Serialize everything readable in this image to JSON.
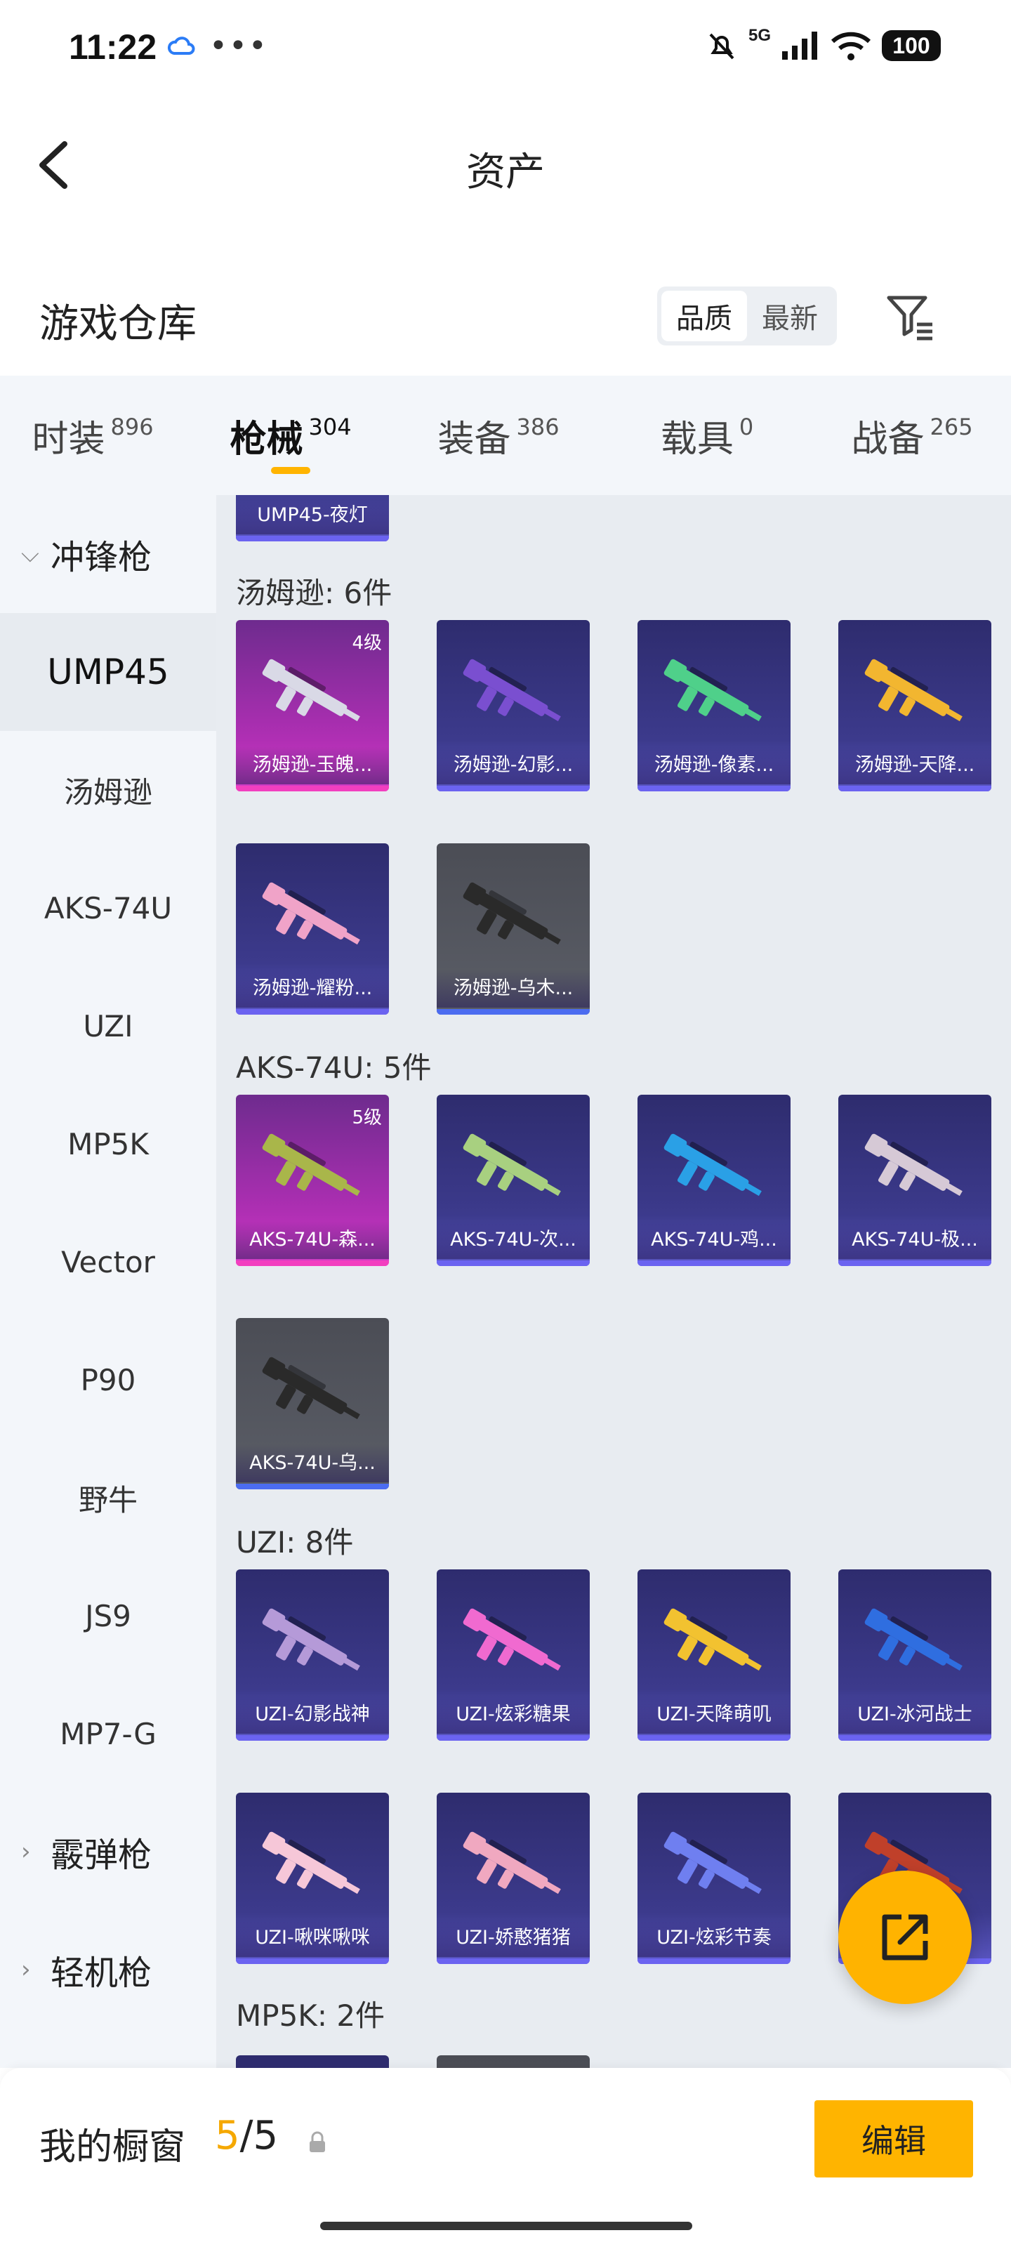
{
  "status_bar": {
    "time": "11:22",
    "network": "5G",
    "battery": "100"
  },
  "header": {
    "title": "资产"
  },
  "warehouse": {
    "title": "游戏仓库",
    "sort_options": [
      "品质",
      "最新"
    ],
    "active_sort": "品质"
  },
  "category_tabs": [
    {
      "label": "时装",
      "count": "896"
    },
    {
      "label": "枪械",
      "count": "304",
      "active": true
    },
    {
      "label": "装备",
      "count": "386"
    },
    {
      "label": "载具",
      "count": "0"
    },
    {
      "label": "战备",
      "count": "265"
    }
  ],
  "sidebar": {
    "group_smg": "冲锋枪",
    "items": [
      "UMP45",
      "汤姆逊",
      "AKS-74U",
      "UZI",
      "MP5K",
      "Vector",
      "P90",
      "野牛",
      "JS9",
      "MP7-G"
    ],
    "active_item": "UMP45",
    "group_shotgun": "霰弹枪",
    "group_lmg": "轻机枪"
  },
  "sections": {
    "prev_card": {
      "name": "UMP45-夜灯"
    },
    "thompson": {
      "title": "汤姆逊: 6件",
      "cards": [
        {
          "name": "汤姆逊-玉魄...",
          "level": "4级",
          "rarity": "legendary",
          "gun_color": "#d9d9e6"
        },
        {
          "name": "汤姆逊-幻影...",
          "rarity": "epic",
          "gun_color": "#7a4fd0"
        },
        {
          "name": "汤姆逊-像素...",
          "rarity": "epic",
          "gun_color": "#4fd08a"
        },
        {
          "name": "汤姆逊-天降...",
          "rarity": "epic",
          "gun_color": "#f2b630"
        },
        {
          "name": "汤姆逊-耀粉...",
          "rarity": "epic",
          "gun_color": "#f0a3c8"
        },
        {
          "name": "汤姆逊-乌木...",
          "rarity": "rare",
          "gun_color": "#2a2a2a"
        }
      ]
    },
    "aks": {
      "title": "AKS-74U: 5件",
      "cards": [
        {
          "name": "AKS-74U-森...",
          "level": "5级",
          "rarity": "legendary",
          "gun_color": "#a9b64a"
        },
        {
          "name": "AKS-74U-次...",
          "rarity": "epic",
          "gun_color": "#a8d080"
        },
        {
          "name": "AKS-74U-鸡...",
          "rarity": "epic",
          "gun_color": "#2aa0e6"
        },
        {
          "name": "AKS-74U-极...",
          "rarity": "epic",
          "gun_color": "#d6c9d6"
        },
        {
          "name": "AKS-74U-乌...",
          "rarity": "rare",
          "gun_color": "#2a2a2a"
        }
      ]
    },
    "uzi": {
      "title": "UZI: 8件",
      "cards": [
        {
          "name": "UZI-幻影战神",
          "rarity": "epic",
          "gun_color": "#b59ad8"
        },
        {
          "name": "UZI-炫彩糖果",
          "rarity": "epic",
          "gun_color": "#f06ad0"
        },
        {
          "name": "UZI-天降萌叽",
          "rarity": "epic",
          "gun_color": "#f2c230"
        },
        {
          "name": "UZI-冰河战士",
          "rarity": "epic",
          "gun_color": "#2f6ee0"
        },
        {
          "name": "UZI-啾咪啾咪",
          "rarity": "epic",
          "gun_color": "#f6c7d8"
        },
        {
          "name": "UZI-娇憨猪猪",
          "rarity": "epic",
          "gun_color": "#f0a8c0"
        },
        {
          "name": "UZI-炫彩节奏",
          "rarity": "epic",
          "gun_color": "#6f7ff0"
        },
        {
          "name": "",
          "rarity": "epic",
          "gun_color": "#c0402a"
        }
      ]
    },
    "mp5k": {
      "title": "MP5K: 2件"
    }
  },
  "bottom_bar": {
    "showcase_label": "我的橱窗",
    "showcase_current": "5",
    "showcase_total": "/5",
    "edit_label": "编辑"
  },
  "colors": {
    "accent": "#ffb400",
    "legendary": "#f23fbf",
    "epic": "#6b63f0"
  }
}
